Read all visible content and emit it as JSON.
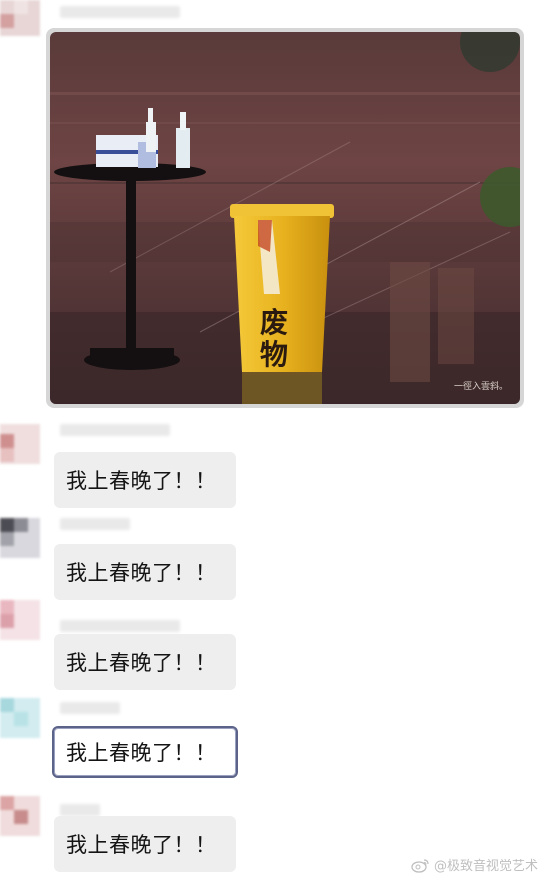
{
  "chat": {
    "image_message": {
      "photo_caption_text": "废物",
      "watermark": "一徑入雲斜。"
    },
    "messages": [
      {
        "text": "我上春晚了！！"
      },
      {
        "text": "我上春晚了！！"
      },
      {
        "text": "我上春晚了！！"
      },
      {
        "text": "我上春晚了！！"
      },
      {
        "text": "我上春晚了！！"
      }
    ],
    "highlighted_index": 3
  },
  "watermark_footer": {
    "handle": "@极致音视觉艺术",
    "icon": "weibo-icon"
  },
  "colors": {
    "bubble_bg": "#eeeeee",
    "selected_border": "#5c6389",
    "bin_yellow": "#e8b21f"
  }
}
